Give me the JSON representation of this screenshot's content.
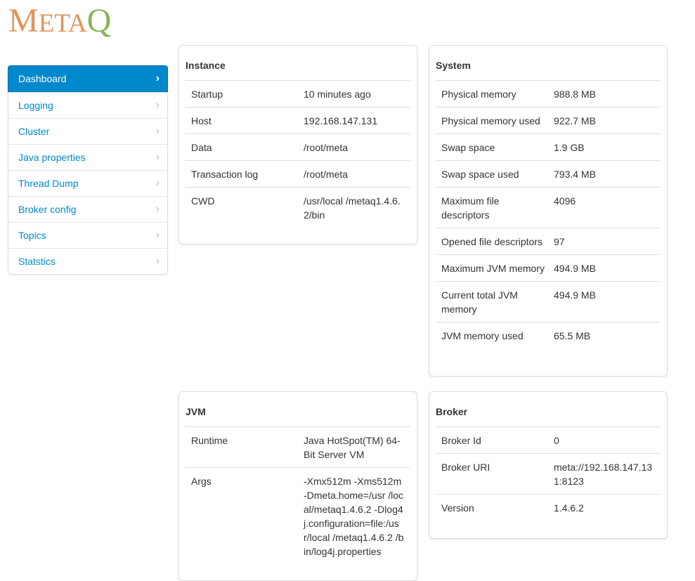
{
  "app": {
    "logo_letters": [
      "M",
      "ETA",
      "Q"
    ],
    "logo_colors": {
      "main": "#e0945a",
      "accent": "#8ab45a"
    }
  },
  "sidebar": {
    "items": [
      {
        "label": "Dashboard",
        "active": true,
        "icon": "chevron-right-icon"
      },
      {
        "label": "Logging",
        "icon": "chevron-right-icon"
      },
      {
        "label": "Cluster",
        "icon": "chevron-right-icon"
      },
      {
        "label": "Java properties",
        "icon": "chevron-right-icon"
      },
      {
        "label": "Thread Dump",
        "icon": "chevron-right-icon"
      },
      {
        "label": "Broker config",
        "icon": "chevron-right-icon"
      },
      {
        "label": "Topics",
        "icon": "chevron-right-icon"
      },
      {
        "label": "Statstics",
        "icon": "chevron-right-icon"
      }
    ],
    "chevron_glyph": "›"
  },
  "instance": {
    "title": "Instance",
    "rows": [
      {
        "key": "Startup",
        "value": "10 minutes ago"
      },
      {
        "key": "Host",
        "value": "192.168.147.131"
      },
      {
        "key": "Data",
        "value": "/root/meta"
      },
      {
        "key": "Transaction log",
        "value": "/root/meta"
      },
      {
        "key": "CWD",
        "value": "/usr/local /metaq1.4.6.2/bin"
      }
    ]
  },
  "system": {
    "title": "System",
    "rows": [
      {
        "key": "Physical memory",
        "value": "988.8 MB"
      },
      {
        "key": "Physical memory used",
        "value": "922.7 MB"
      },
      {
        "key": "Swap space",
        "value": "1.9 GB"
      },
      {
        "key": "Swap space used",
        "value": "793.4 MB"
      },
      {
        "key": "Maximum file descriptors",
        "value": "4096"
      },
      {
        "key": "Opened file descriptors",
        "value": "97"
      },
      {
        "key": "Maximum JVM memory",
        "value": "494.9 MB"
      },
      {
        "key": "Current total JVM memory",
        "value": "494.9 MB"
      },
      {
        "key": "JVM memory used",
        "value": "65.5 MB"
      }
    ]
  },
  "jvm": {
    "title": "JVM",
    "rows": [
      {
        "key": "Runtime",
        "value": "Java HotSpot(TM) 64-Bit Server VM"
      },
      {
        "key": "Args",
        "value": "-Xmx512m -Xms512m -Dmeta.home=/usr /local/metaq1.4.6.2 -Dlog4j.configuration=file:/usr/local /metaq1.4.6.2 /bin/log4j.properties"
      }
    ]
  },
  "broker": {
    "title": "Broker",
    "rows": [
      {
        "key": "Broker Id",
        "value": "0"
      },
      {
        "key": "Broker URI",
        "value": "meta://192.168.147.131:8123"
      },
      {
        "key": "Version",
        "value": "1.4.6.2"
      }
    ]
  }
}
